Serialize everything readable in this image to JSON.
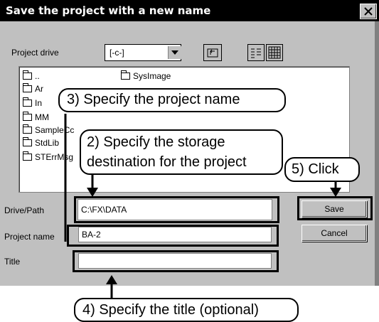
{
  "dialog": {
    "title": "Save the project with a new name",
    "project_drive_label": "Project drive",
    "drive_value": "[-c-]",
    "file_list": [
      "..",
      "Ar",
      "In",
      "MM",
      "SampleCc",
      "StdLib",
      "STErrMsg",
      "SysImage"
    ],
    "drive_path_label": "Drive/Path",
    "drive_path_value": "C:\\FX\\DATA",
    "project_name_label": "Project name",
    "project_name_value": "BA-2",
    "title_label": "Title",
    "title_value": "",
    "save_label": "Save",
    "cancel_label": "Cancel"
  },
  "callouts": {
    "step3": "3) Specify the project name",
    "step2_line1": "2) Specify the storage",
    "step2_line2": "destination for the project",
    "step5": "5) Click",
    "step4": "4) Specify the title (optional)"
  }
}
